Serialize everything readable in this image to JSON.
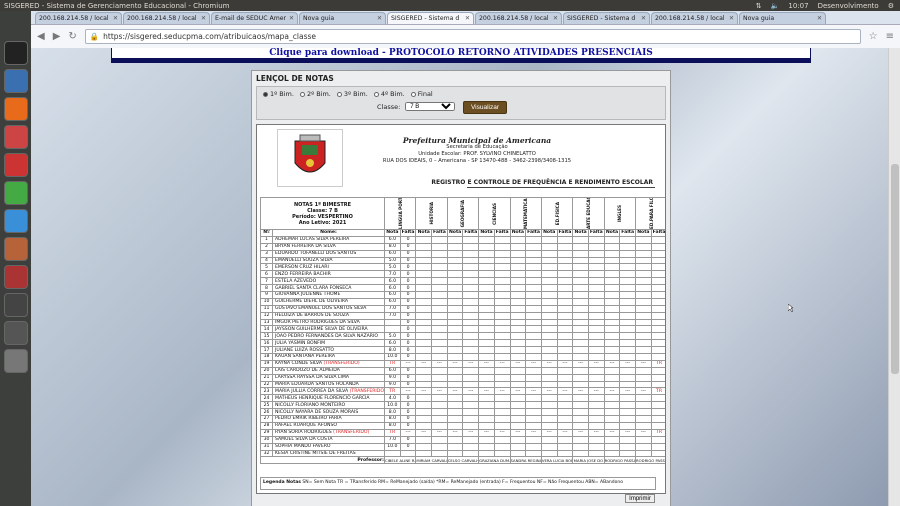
{
  "window": {
    "title": "SISGERED - Sistema de Gerenciamento Educacional - Chromium",
    "clock": "10:07",
    "user": "Desenvolvimento"
  },
  "tabs": [
    {
      "label": "200.168.214.58 / local",
      "active": false
    },
    {
      "label": "200.168.214.58 / local",
      "active": false
    },
    {
      "label": "E-mail de SEDUC Amer",
      "active": false
    },
    {
      "label": "Nova guia",
      "active": false
    },
    {
      "label": "SISGERED - Sistema d",
      "active": true
    },
    {
      "label": "200.168.214.58 / local",
      "active": false
    },
    {
      "label": "SISGERED - Sistema d",
      "active": false
    },
    {
      "label": "200.168.214.58 / local",
      "active": false
    },
    {
      "label": "Nova guia",
      "active": false
    }
  ],
  "url": "https://sisgered.seducpma.com/atribuicaos/mapa_classe",
  "download": "Clique para download - PROTOCOLO RETORNO ATIVIDADES PRESENCIAIS",
  "panel": {
    "title": "LENÇOL DE NOTAS",
    "periods": [
      {
        "label": "1º Bim.",
        "on": true
      },
      {
        "label": "2º Bim.",
        "on": false
      },
      {
        "label": "3º Bim.",
        "on": false
      },
      {
        "label": "4º Bim.",
        "on": false
      },
      {
        "label": "Final",
        "on": false
      }
    ],
    "class_label": "Classe:",
    "class_value": "7 B",
    "button": "Visualizar"
  },
  "sheet": {
    "pref": "Prefeitura Municipal de Americana",
    "sec": "Secretaria de Educação",
    "school": "Unidade Escolar: PROF. SYLVINO CHINELATTO",
    "addr": "RUA DOS IDEAIS, 0 – Americana - SP 13470-488 - 3462-2398/3408-1315",
    "registro": "REGISTRO E CONTROLE DE FREQUÊNCIA E RENDIMENTO ESCOLAR",
    "box": [
      "NOTAS 1º BIMESTRE",
      "Classe: 7 B",
      "Período: VESPERTINO",
      "Ano Letivo: 2021"
    ],
    "subjects": [
      "LINGUA PORTUGUESA",
      "HISTÓRIA",
      "GEOGRAFIA",
      "CIENCIAS",
      "MATEMÁTICA",
      "ED.FISICA",
      "ARTE EDUCAÇÃO",
      "INGLES",
      "ED.PARA FILOS."
    ],
    "col_n": "Nº",
    "col_nome": "Nome:",
    "col_nota": "Nota",
    "col_falta": "Falta",
    "students": [
      [
        "1",
        "ADHEMAR LUCAS SILVA PEREIRA",
        "6.0",
        "0"
      ],
      [
        "2",
        "BRYAN FERREIRA DA SILVA",
        "8.0",
        "0"
      ],
      [
        "3",
        "EDUARDO TOFANELLI DOS SANTOS",
        "6.0",
        "0"
      ],
      [
        "4",
        "EMANUELLI SOUZA SILVA",
        "5.0",
        "0"
      ],
      [
        "5",
        "EMERSON CRUZ HILARI",
        "5.0",
        "0"
      ],
      [
        "6",
        "ENZO FERREIRA BACHIR",
        "7.0",
        "0"
      ],
      [
        "7",
        "ESTELA AZEVEDO",
        "6.0",
        "0"
      ],
      [
        "8",
        "GABRIEL SANTA CLARA FONSECA",
        "6.0",
        "0"
      ],
      [
        "9",
        "GIOVANNA JULIENNE THOMÉ",
        "6.0",
        "0"
      ],
      [
        "10",
        "GUILHERME DIEHL DE OLIVEIRA",
        "6.0",
        "0"
      ],
      [
        "11",
        "GUSTAVO EMANUEL DOS SANTOS SILVA",
        "7.0",
        "0"
      ],
      [
        "12",
        "HELOIZA DE BARROS DE SOUZA",
        "7.0",
        "0"
      ],
      [
        "13",
        "IMGOR PIETRO RODRIGUES DA SILVA",
        "",
        "0"
      ],
      [
        "14",
        "JAYSSON GUILHERME SILVA DE OLIVEIRA",
        "",
        "0"
      ],
      [
        "15",
        "JOAO PEDRO FERNANDES DA SILVA NAZARIO",
        "5.0",
        "0"
      ],
      [
        "16",
        "JULIA YASMIN BONFIM",
        "6.0",
        "0"
      ],
      [
        "17",
        "JULIANE LUIZA ROSSATTO",
        "8.0",
        "0"
      ],
      [
        "18",
        "KAUAN SANTANA PEREIRA",
        "10.0",
        "0"
      ],
      [
        "19",
        "KAYNÁ CONDE SILVA (TRANSFERIDO)",
        "TR",
        "---"
      ],
      [
        "20",
        "LAIS CARDOZO DE ALMEIDA",
        "6.0",
        "0"
      ],
      [
        "21",
        "LARYSSA RAYSSA DA SILVA LIMA",
        "9.0",
        "0"
      ],
      [
        "22",
        "MARIA EDUARDA SANTOS HOLANDA",
        "9.0",
        "0"
      ],
      [
        "23",
        "MARIA JULLIA CORREA DA SILVA (TRANSFERIDO)",
        "TR",
        "---"
      ],
      [
        "24",
        "MATHEUS HENRIQUE FLORENCIO GARCIA",
        "4.0",
        "0"
      ],
      [
        "25",
        "NICOLLY FLORIANO MONTEIRO",
        "10.0",
        "0"
      ],
      [
        "26",
        "NICOLLY NAYARA DE SOUZA MORAIS",
        "8.0",
        "0"
      ],
      [
        "27",
        "PEDRO EMRIK RIBEIRO FARIA",
        "8.0",
        "0"
      ],
      [
        "28",
        "RAFAEL RUARQUE AFONSO",
        "8.0",
        "0"
      ],
      [
        "29",
        "RYAN SORIA RODRIGUES (TRANSFERIDO)",
        "TR",
        "---"
      ],
      [
        "30",
        "SAMUEL SILVA DA COSTA",
        "7.0",
        "0"
      ],
      [
        "31",
        "SOPHIA MANDU FAVERO",
        "10.0",
        "0"
      ],
      [
        "32",
        "KESIA CRISTINE MITSIE DE FREITAS",
        "",
        ""
      ]
    ],
    "professor_label": "Professor:",
    "teachers": [
      "CIBELE ALINE R...",
      "MIRIAM CARVALH...",
      "CELSO CARVALHO",
      "GRAZIANA DUM...",
      "SANDRA REGINA",
      "VERA LUCIA BOR...",
      "MARIA JOSE DO",
      "RODRIGO PASSAO...",
      "RODRIGO PASSAO..."
    ],
    "legend_label": "Legenda Notas",
    "legend": "SN= Sem Nota    TR = TRansferido    RM= ReManejado (saída)    *RM= ReManejado (entrada) F= Frequentou    NF= Não Frequentou    ABN= ABandono"
  },
  "print_button": "Imprimir"
}
